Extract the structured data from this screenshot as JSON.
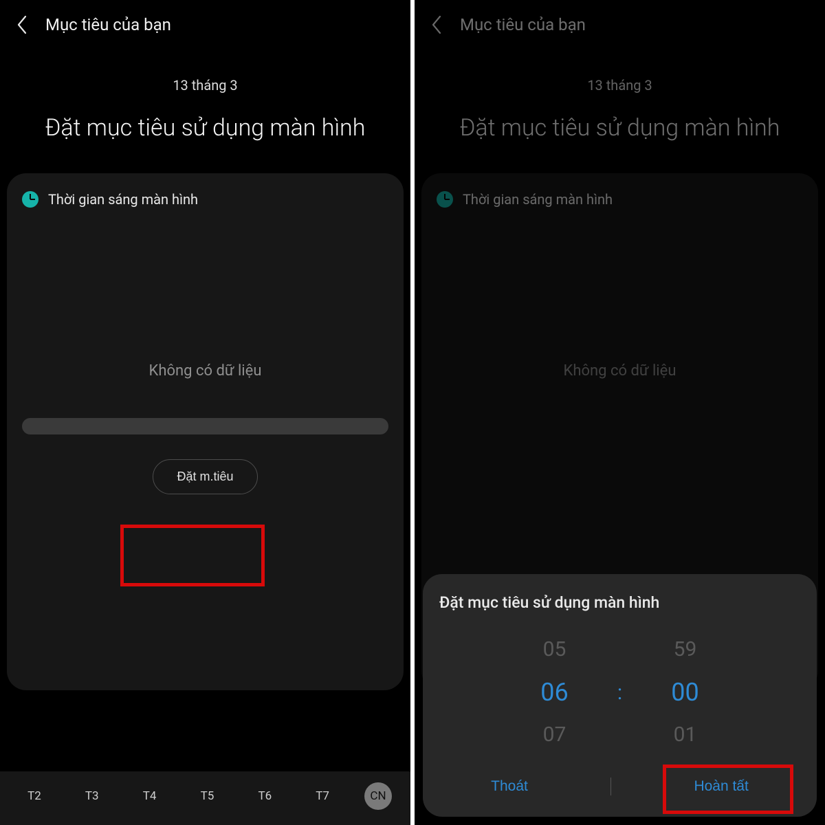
{
  "left": {
    "header_title": "Mục tiêu của bạn",
    "date": "13 tháng 3",
    "subtitle": "Đặt mục tiêu sử dụng màn hình",
    "card_label": "Thời gian sáng màn hình",
    "no_data": "Không có dữ liệu",
    "set_goal_label": "Đặt m.tiêu",
    "weekdays": [
      "T2",
      "T3",
      "T4",
      "T5",
      "T6",
      "T7",
      "CN"
    ]
  },
  "right": {
    "header_title": "Mục tiêu của bạn",
    "date": "13 tháng 3",
    "subtitle": "Đặt mục tiêu sử dụng màn hình",
    "card_label": "Thời gian sáng màn hình",
    "no_data": "Không có dữ liệu",
    "sheet": {
      "title": "Đặt mục tiêu sử dụng màn hình",
      "hours_prev": "05",
      "hours_cur": "06",
      "hours_next": "07",
      "mins_prev": "59",
      "mins_cur": "00",
      "mins_next": "01",
      "colon": ":",
      "cancel": "Thoát",
      "done": "Hoàn tất"
    }
  }
}
